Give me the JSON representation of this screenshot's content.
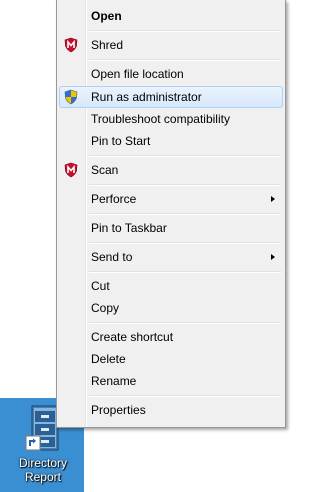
{
  "menu": {
    "items": [
      {
        "label": "Open",
        "icon": ""
      },
      {
        "label": "Shred",
        "icon": "mcafee-shield-icon"
      },
      {
        "label": "Open file location",
        "icon": ""
      },
      {
        "label": "Run as administrator",
        "icon": "uac-shield-icon"
      },
      {
        "label": "Troubleshoot compatibility",
        "icon": ""
      },
      {
        "label": "Pin to Start",
        "icon": ""
      },
      {
        "label": "Scan",
        "icon": "mcafee-shield-icon"
      },
      {
        "label": "Perforce",
        "icon": "submenu-arrow-icon"
      },
      {
        "label": "Pin to Taskbar",
        "icon": ""
      },
      {
        "label": "Send to",
        "icon": "submenu-arrow-icon"
      },
      {
        "label": "Cut",
        "icon": ""
      },
      {
        "label": "Copy",
        "icon": ""
      },
      {
        "label": "Create shortcut",
        "icon": ""
      },
      {
        "label": "Delete",
        "icon": ""
      },
      {
        "label": "Rename",
        "icon": ""
      },
      {
        "label": "Properties",
        "icon": ""
      }
    ],
    "highlighted": "Run as administrator"
  },
  "desktop": {
    "icon_label_line1": "Directory",
    "icon_label_line2": "Report",
    "icon": "filing-cabinet-shortcut-icon"
  },
  "colors": {
    "menu_background": "#f0f0f0",
    "highlight_fill": "#d7e8fb",
    "highlight_border": "#aecff7",
    "desktop_background": "#3a8fd3",
    "mcafee_red": "#c8102e"
  }
}
